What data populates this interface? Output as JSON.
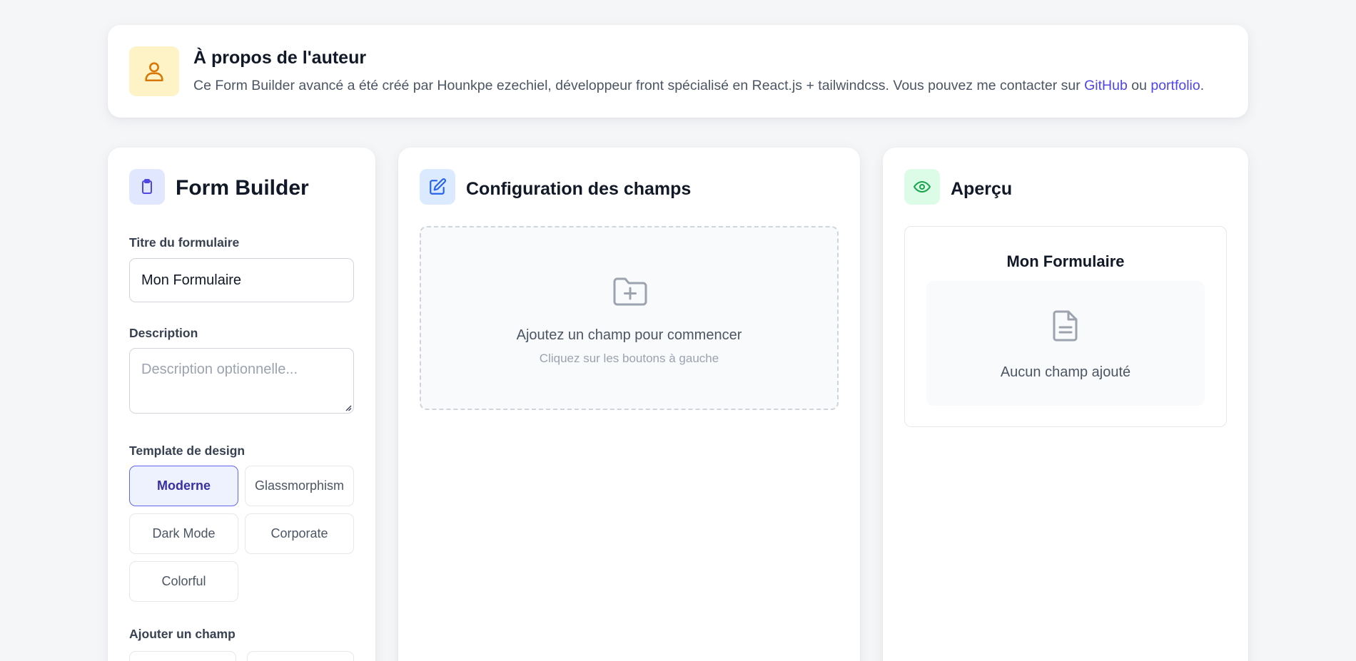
{
  "about": {
    "title": "À propos de l'auteur",
    "text": "Ce Form Builder avancé a été créé par Hounkpe ezechiel, développeur front spécialisé en React.js + tailwindcss. Vous pouvez me contacter sur ",
    "github_label": "GitHub",
    "conjunction": " ou ",
    "portfolio_label": "portfolio",
    "end": ".",
    "icon": "user-icon"
  },
  "builder": {
    "title": "Form Builder",
    "icon": "clipboard-icon",
    "title_label": "Titre du formulaire",
    "title_value": "Mon Formulaire",
    "description_label": "Description",
    "description_placeholder": "Description optionnelle...",
    "template_label": "Template de design",
    "templates": [
      "Moderne",
      "Glassmorphism",
      "Dark Mode",
      "Corporate",
      "Colorful"
    ],
    "selected_template": "Moderne",
    "add_field_label": "Ajouter un champ"
  },
  "config": {
    "title": "Configuration des champs",
    "icon": "edit-icon",
    "empty_title": "Ajoutez un champ pour commencer",
    "empty_subtitle": "Cliquez sur les boutons à gauche",
    "empty_icon": "folder-plus-icon"
  },
  "preview": {
    "title": "Aperçu",
    "icon": "eye-icon",
    "form_title": "Mon Formulaire",
    "empty_text": "Aucun champ ajouté",
    "empty_icon": "document-icon"
  },
  "colors": {
    "accent": "#4f46e5",
    "about_icon_bg": "#fef3c7",
    "about_icon": "#d97706",
    "builder_icon_bg": "#e0e7ff",
    "config_icon_bg": "#dbeafe",
    "preview_icon_bg": "#dcfce7",
    "preview_icon": "#16a34a"
  }
}
